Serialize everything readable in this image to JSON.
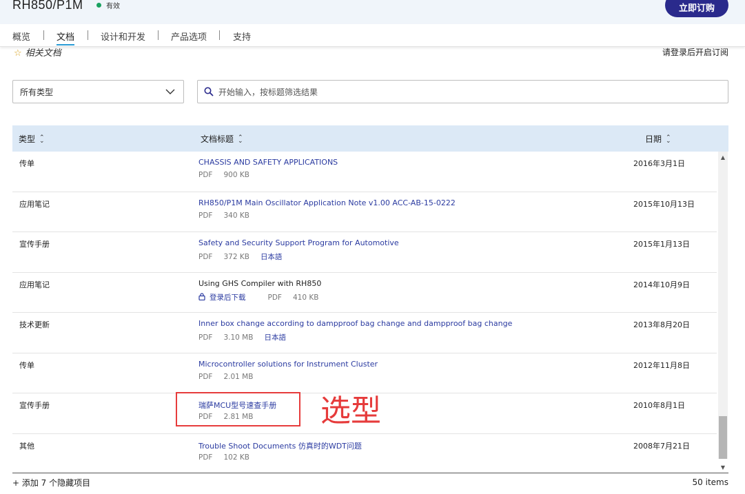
{
  "header": {
    "product_title": "RH850/P1M",
    "status": "有效",
    "buy_button": "立即订购",
    "status_color": "#1aa260",
    "accent": "#2a2a8c"
  },
  "tabs": [
    {
      "label": "概览"
    },
    {
      "label": "文档"
    },
    {
      "label": "设计和开发"
    },
    {
      "label": "产品选项"
    },
    {
      "label": "支持"
    }
  ],
  "active_tab": "文档",
  "related_docs": "相关文档",
  "login_subscribe": "请登录后开启订阅",
  "filter": {
    "type_select": "所有类型",
    "search_placeholder": "开始输入，按标题筛选结果"
  },
  "table": {
    "headers": {
      "type": "类型",
      "title": "文档标题",
      "date": "日期"
    },
    "rows": [
      {
        "type": "传单",
        "title": "CHASSIS AND SAFETY APPLICATIONS",
        "format": "PDF",
        "size": "900 KB",
        "date": "2016年3月1日"
      },
      {
        "type": "应用笔记",
        "title": "RH850/P1M Main Oscillator Application Note v1.00 ACC-AB-15-0222",
        "format": "PDF",
        "size": "340 KB",
        "date": "2015年10月13日"
      },
      {
        "type": "宣传手册",
        "title": "Safety and Security Support Program for Automotive",
        "format": "PDF",
        "size": "372 KB",
        "lang": "日本語",
        "date": "2015年1月13日"
      },
      {
        "type": "应用笔记",
        "title": "Using GHS Compiler with RH850",
        "login": "登录后下载",
        "format": "PDF",
        "size": "410 KB",
        "date": "2014年10月9日"
      },
      {
        "type": "技术更新",
        "title": "Inner box change according to dampproof bag change and dampproof bag change",
        "format": "PDF",
        "size": "3.10 MB",
        "lang": "日本語",
        "date": "2013年8月20日"
      },
      {
        "type": "传单",
        "title": "Microcontroller solutions for Instrument Cluster",
        "format": "PDF",
        "size": "2.01 MB",
        "date": "2012年11月8日"
      },
      {
        "type": "宣传手册",
        "title": "瑞萨MCU型号速查手册",
        "format": "PDF",
        "size": "2.81 MB",
        "date": "2010年8月1日"
      },
      {
        "type": "其他",
        "title": "Trouble Shoot Documents 仿真时的WDT问题",
        "format": "PDF",
        "size": "102 KB",
        "date": "2008年7月21日"
      }
    ]
  },
  "footer": {
    "add_hidden": "+ 添加 7 个隐藏项目",
    "count": "50 items"
  },
  "annotation": {
    "text": "选型",
    "color": "#e63b3b"
  }
}
